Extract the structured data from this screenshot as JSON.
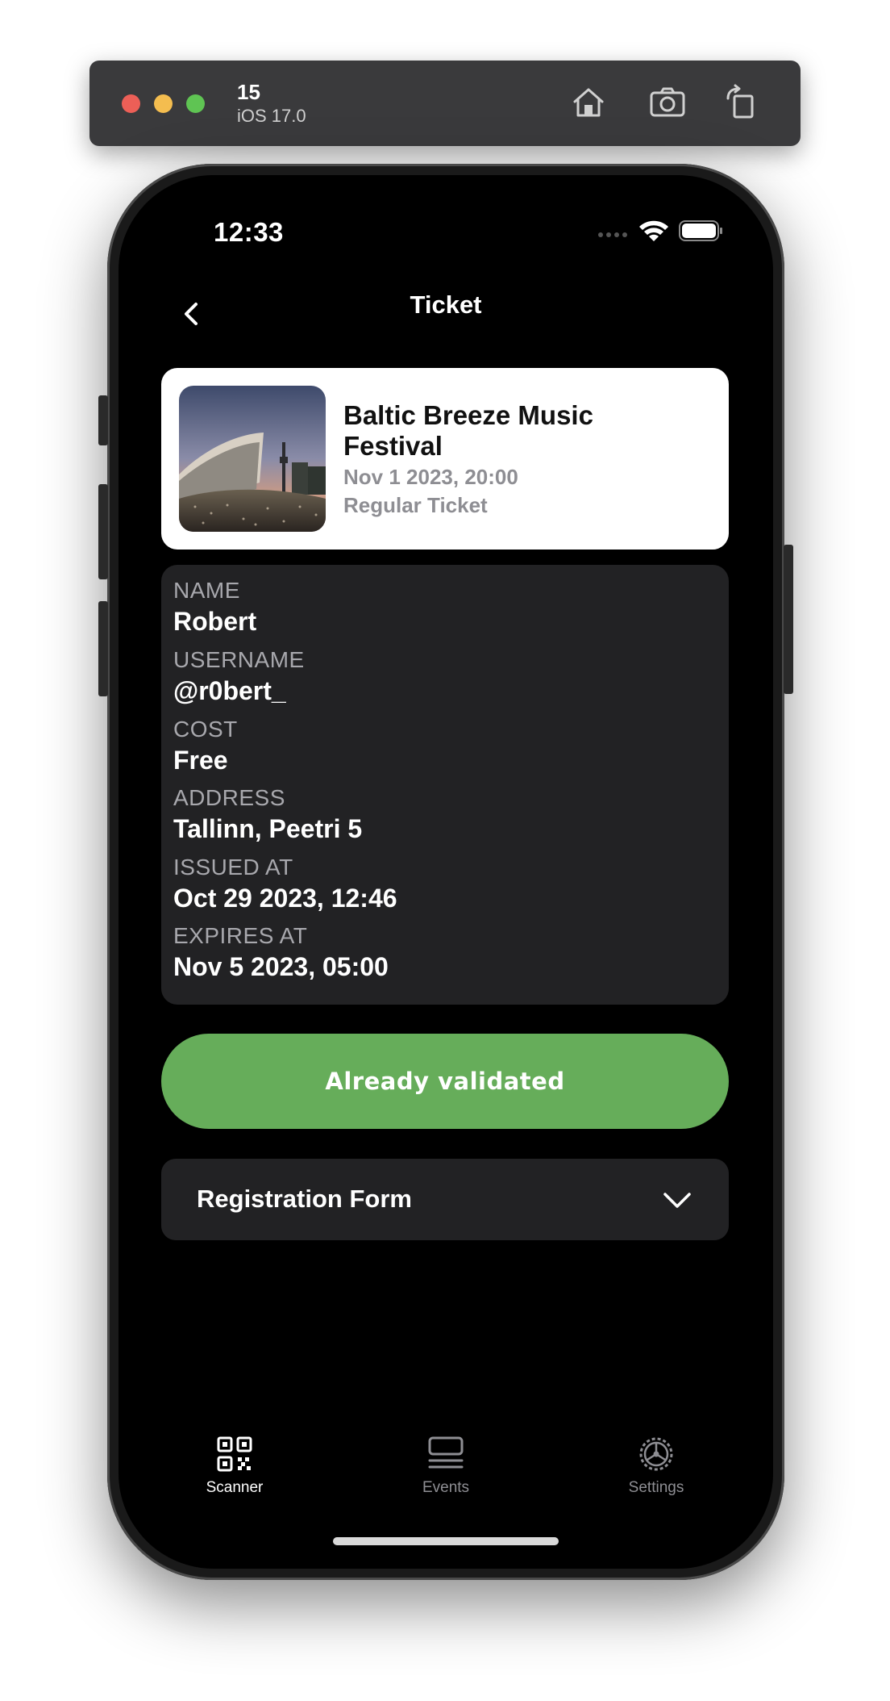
{
  "simulator": {
    "device_name": "15",
    "os_version": "iOS 17.0",
    "toolbar_icons": [
      "home-icon",
      "screenshot-icon",
      "rotate-icon"
    ]
  },
  "status_bar": {
    "time": "12:33",
    "icons": [
      "signal-icon",
      "wifi-icon",
      "battery-icon"
    ]
  },
  "nav": {
    "title": "Ticket",
    "back_icon": "chevron-left-icon"
  },
  "event": {
    "name": "Baltic Breeze Music Festival",
    "date": "Nov 1 2023, 20:00",
    "ticket_type": "Regular Ticket"
  },
  "details": [
    {
      "label": "NAME",
      "value": "Robert"
    },
    {
      "label": "USERNAME",
      "value": "@r0bert_"
    },
    {
      "label": "COST",
      "value": "Free"
    },
    {
      "label": "ADDRESS",
      "value": "Tallinn, Peetri 5"
    },
    {
      "label": "ISSUED AT",
      "value": "Oct 29 2023, 12:46"
    },
    {
      "label": "EXPIRES AT",
      "value": "Nov 5 2023, 05:00"
    }
  ],
  "validation": {
    "label": "Already validated",
    "color": "#66ad5a"
  },
  "registration_form": {
    "label": "Registration Form",
    "icon": "chevron-down-icon"
  },
  "tabs": [
    {
      "label": "Scanner",
      "icon": "qr-code-icon",
      "active": true
    },
    {
      "label": "Events",
      "icon": "events-list-icon",
      "active": false
    },
    {
      "label": "Settings",
      "icon": "gear-icon",
      "active": false
    }
  ],
  "colors": {
    "background": "#000000",
    "card": "#222224",
    "accent_green": "#66ad5a",
    "inactive_tab": "#8e8e93"
  }
}
